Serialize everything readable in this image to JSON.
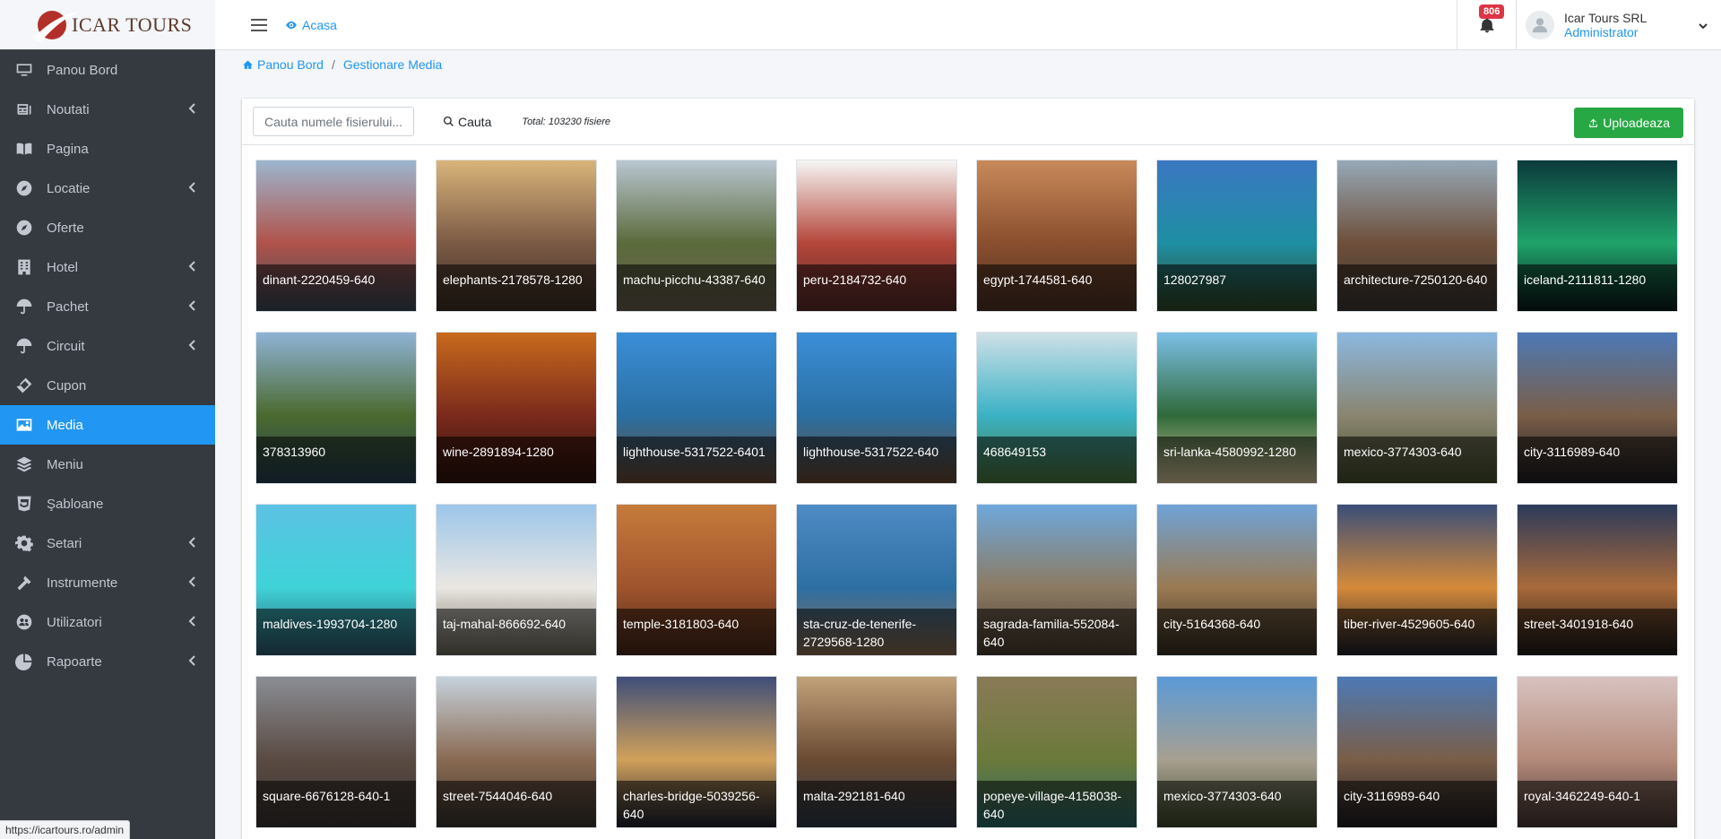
{
  "brand": {
    "name": "ICAR TOURS"
  },
  "sidebar": {
    "items": [
      {
        "label": "Panou Bord",
        "icon": "monitor-icon",
        "chevron": false,
        "active": false
      },
      {
        "label": "Noutati",
        "icon": "newspaper-icon",
        "chevron": true,
        "active": false
      },
      {
        "label": "Pagina",
        "icon": "book-icon",
        "chevron": false,
        "active": false
      },
      {
        "label": "Locatie",
        "icon": "compass-icon",
        "chevron": true,
        "active": false
      },
      {
        "label": "Oferte",
        "icon": "compass-icon",
        "chevron": false,
        "active": false
      },
      {
        "label": "Hotel",
        "icon": "building-icon",
        "chevron": true,
        "active": false
      },
      {
        "label": "Pachet",
        "icon": "umbrella-icon",
        "chevron": true,
        "active": false
      },
      {
        "label": "Circuit",
        "icon": "umbrella-icon",
        "chevron": true,
        "active": false
      },
      {
        "label": "Cupon",
        "icon": "ticket-icon",
        "chevron": false,
        "active": false
      },
      {
        "label": "Media",
        "icon": "image-icon",
        "chevron": false,
        "active": true
      },
      {
        "label": "Meniu",
        "icon": "layers-icon",
        "chevron": false,
        "active": false
      },
      {
        "label": "Şabloane",
        "icon": "html5-icon",
        "chevron": false,
        "active": false
      },
      {
        "label": "Setari",
        "icon": "gear-icon",
        "chevron": true,
        "active": false
      },
      {
        "label": "Instrumente",
        "icon": "hammer-icon",
        "chevron": true,
        "active": false
      },
      {
        "label": "Utilizatori",
        "icon": "users-icon",
        "chevron": true,
        "active": false
      },
      {
        "label": "Rapoarte",
        "icon": "pie-chart-icon",
        "chevron": true,
        "active": false
      }
    ]
  },
  "status_bar": {
    "url": "https://icartours.ro/admin"
  },
  "topbar": {
    "home_label": "Acasa",
    "notifications_count": "806",
    "user_name": "Icar Tours SRL",
    "user_role": "Administrator"
  },
  "breadcrumb": {
    "home": "Panou Bord",
    "current": "Gestionare Media"
  },
  "toolbar": {
    "search_placeholder": "Cauta numele fisierului...",
    "search_label": "Cauta",
    "total": "Total: 103230 fisiere",
    "upload_label": "Uploadeaza"
  },
  "colors": {
    "accent": "#2196f3",
    "sidebar_bg": "#343a40",
    "upload": "#28a745",
    "badge": "#dc3545"
  },
  "media": [
    {
      "name": "dinant-2220459-640",
      "c1": "#9cb6cf",
      "c2": "#b0534a",
      "c3": "#3b4b5a"
    },
    {
      "name": "elephants-2178578-1280",
      "c1": "#d9b47a",
      "c2": "#7b5a45",
      "c3": "#3d2f25"
    },
    {
      "name": "machu-picchu-43387-640",
      "c1": "#b9c7d2",
      "c2": "#5b6a3b",
      "c3": "#6b6151"
    },
    {
      "name": "peru-2184732-640",
      "c1": "#f6f6f4",
      "c2": "#b4463a",
      "c3": "#5a2e2b"
    },
    {
      "name": "egypt-1744581-640",
      "c1": "#c88a5a",
      "c2": "#8a4e2e",
      "c3": "#4f3426"
    },
    {
      "name": "128027987",
      "c1": "#3a77c1",
      "c2": "#1e8fa3",
      "c3": "#314a26"
    },
    {
      "name": "architecture-7250120-640",
      "c1": "#96a9b8",
      "c2": "#6e4f3a",
      "c3": "#3f3a34"
    },
    {
      "name": "iceland-2111811-1280",
      "c1": "#0c3a3c",
      "c2": "#1fa36a",
      "c3": "#081a1b"
    },
    {
      "name": "378313960",
      "c1": "#8fb3d6",
      "c2": "#4b6a2f",
      "c3": "#254052"
    },
    {
      "name": "wine-2891894-1280",
      "c1": "#c86a1c",
      "c2": "#7b2a1c",
      "c3": "#2d120b"
    },
    {
      "name": "lighthouse-5317522-6401",
      "c1": "#3b8fd8",
      "c2": "#2a6fa3",
      "c3": "#6b4b34"
    },
    {
      "name": "lighthouse-5317522-640",
      "c1": "#3b8fd8",
      "c2": "#2a6fa3",
      "c3": "#6b4b34"
    },
    {
      "name": "468649153",
      "c1": "#cfe0e7",
      "c2": "#3ab2c5",
      "c3": "#4c7a3c"
    },
    {
      "name": "sri-lanka-4580992-1280",
      "c1": "#7cc0e8",
      "c2": "#2f6a3a",
      "c3": "#d7c59a"
    },
    {
      "name": "mexico-3774303-640",
      "c1": "#8bb8e0",
      "c2": "#8a8570",
      "c3": "#45502c"
    },
    {
      "name": "city-3116989-640",
      "c1": "#4d79b5",
      "c2": "#7a5e48",
      "c3": "#1e1d22"
    },
    {
      "name": "maldives-1993704-1280",
      "c1": "#5cc2e4",
      "c2": "#3fd3d8",
      "c3": "#2e5c70"
    },
    {
      "name": "taj-mahal-866692-640",
      "c1": "#9cc6ea",
      "c2": "#ebe7e2",
      "c3": "#6d6a5c"
    },
    {
      "name": "temple-3181803-640",
      "c1": "#c67b3b",
      "c2": "#a0542d",
      "c3": "#4a2a1a"
    },
    {
      "name": "sta-cruz-de-tenerife-2729568-1280",
      "c1": "#4f8bc5",
      "c2": "#2d6fa3",
      "c3": "#8a6a4c"
    },
    {
      "name": "sagrada-familia-552084-640",
      "c1": "#6ea8dc",
      "c2": "#8c7a62",
      "c3": "#4a3e31"
    },
    {
      "name": "city-5164368-640",
      "c1": "#6fa3d7",
      "c2": "#9a7a52",
      "c3": "#3a3023"
    },
    {
      "name": "tiber-river-4529605-640",
      "c1": "#3a4e78",
      "c2": "#d58a3a",
      "c3": "#1e1f28"
    },
    {
      "name": "street-3401918-640",
      "c1": "#2b3a5a",
      "c2": "#a86a3a",
      "c3": "#1e1a18"
    },
    {
      "name": "square-6676128-640-1",
      "c1": "#8a8e94",
      "c2": "#5a4a42",
      "c3": "#3a3532"
    },
    {
      "name": "street-7544046-640",
      "c1": "#c6d2dc",
      "c2": "#8a6a52",
      "c3": "#3d3630"
    },
    {
      "name": "charles-bridge-5039256-640",
      "c1": "#3f4e7a",
      "c2": "#d1a15a",
      "c3": "#1e2230"
    },
    {
      "name": "malta-292181-640",
      "c1": "#c2a27a",
      "c2": "#6a4a32",
      "c3": "#2e3a4a"
    },
    {
      "name": "popeye-village-4158038-640",
      "c1": "#8a7a58",
      "c2": "#6b7a3a",
      "c3": "#2a6a6a"
    },
    {
      "name": "mexico-3774303-640",
      "c1": "#5b9ad8",
      "c2": "#a8a090",
      "c3": "#3d4a2a"
    },
    {
      "name": "city-3116989-640",
      "c1": "#4d79b5",
      "c2": "#7a5e48",
      "c3": "#1e1d22"
    },
    {
      "name": "royal-3462249-640-1",
      "c1": "#d8c2c0",
      "c2": "#b48a7a",
      "c3": "#4a3a35"
    }
  ]
}
